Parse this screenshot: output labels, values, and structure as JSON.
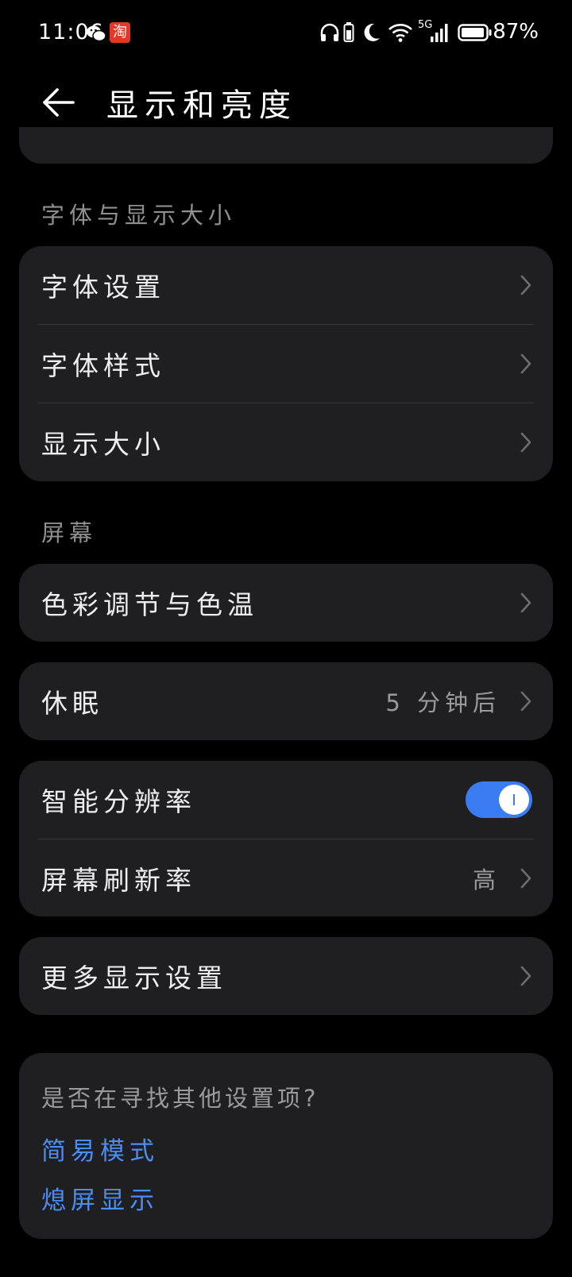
{
  "status_bar": {
    "time": "11:06",
    "taobao_glyph": "淘",
    "signal_label": "5G",
    "battery": "87%",
    "icons": [
      "wechat-icon",
      "taobao-icon",
      "headphones-icon",
      "battery-small-icon",
      "moon-icon",
      "wifi-icon",
      "signal-5g-icon",
      "battery-icon"
    ]
  },
  "header": {
    "title": "显示和亮度"
  },
  "sections": {
    "font_header": "字体与显示大小",
    "screen_header": "屏幕"
  },
  "font_items": [
    {
      "label": "字体设置"
    },
    {
      "label": "字体样式"
    },
    {
      "label": "显示大小"
    }
  ],
  "color_item": {
    "label": "色彩调节与色温"
  },
  "sleep_item": {
    "label": "休眠",
    "value": "5 分钟后"
  },
  "smart_resolution": {
    "label": "智能分辨率",
    "enabled": true
  },
  "refresh_rate": {
    "label": "屏幕刷新率",
    "value": "高"
  },
  "more_display": {
    "label": "更多显示设置"
  },
  "suggestions": {
    "title": "是否在寻找其他设置项?",
    "links": [
      "简易模式",
      "熄屏显示"
    ]
  },
  "colors": {
    "background": "#000000",
    "card": "#1f1f21",
    "accent": "#3a7cf2",
    "link": "#4c8df4"
  }
}
